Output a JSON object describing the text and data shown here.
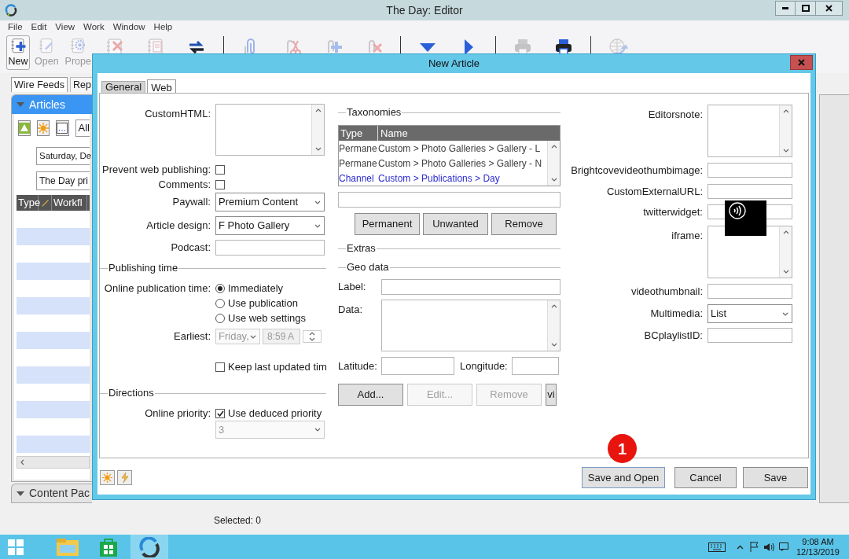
{
  "window": {
    "title": "The Day: Editor"
  },
  "menu": [
    "File",
    "Edit",
    "View",
    "Work",
    "Window",
    "Help"
  ],
  "toolbar": [
    {
      "kind": "new",
      "label": "New",
      "disabled": false,
      "highlighted": true
    },
    {
      "kind": "open",
      "label": "Open",
      "disabled": true,
      "highlighted": false
    },
    {
      "kind": "properties",
      "label": "Prope",
      "disabled": true,
      "highlighted": false
    },
    {
      "kind": "delete",
      "disabled": true,
      "highlighted": false
    },
    {
      "kind": "report",
      "disabled": true,
      "highlighted": false
    },
    {
      "kind": "sync",
      "disabled": false,
      "highlighted": false
    },
    {
      "kind": "separator"
    },
    {
      "kind": "attach",
      "disabled": true,
      "highlighted": false
    },
    {
      "kind": "detach",
      "disabled": true,
      "highlighted": false
    },
    {
      "kind": "attach-add",
      "disabled": true,
      "highlighted": false
    },
    {
      "kind": "attach-remove",
      "disabled": true,
      "highlighted": false
    },
    {
      "kind": "separator"
    },
    {
      "kind": "down",
      "disabled": false,
      "highlighted": false
    },
    {
      "kind": "play",
      "disabled": false,
      "highlighted": false
    },
    {
      "kind": "separator"
    },
    {
      "kind": "print",
      "disabled": true,
      "highlighted": false
    },
    {
      "kind": "print-dark",
      "disabled": false,
      "highlighted": false
    },
    {
      "kind": "separator"
    },
    {
      "kind": "web",
      "disabled": true,
      "highlighted": false
    }
  ],
  "left_panel": {
    "tabs": [
      {
        "label": "Wire Feeds",
        "selected": true
      },
      {
        "label": "Rep",
        "selected": false
      }
    ],
    "articles": {
      "title": "Articles",
      "filter": "All",
      "date": "Saturday, De",
      "edition": "The Day pri",
      "columns": [
        {
          "kind": "text",
          "label": "Type"
        },
        {
          "kind": "pencil"
        },
        {
          "kind": "text",
          "label": "Workfl"
        }
      ]
    },
    "content_panel": {
      "title": "Content Pac"
    }
  },
  "dialog": {
    "title": "New Article",
    "tabs": [
      {
        "label": "General",
        "selected": false
      },
      {
        "label": "Web",
        "selected": true
      }
    ],
    "left": {
      "fields": [
        {
          "kind": "textarea",
          "label": "CustomHTML:"
        },
        {
          "kind": "checkbox",
          "label": "Prevent web publishing:",
          "checked": false
        },
        {
          "kind": "checkbox",
          "label": "Comments:",
          "checked": false
        },
        {
          "kind": "select",
          "label": "Paywall:",
          "value": "Premium Content"
        },
        {
          "kind": "select",
          "label": "Article design:",
          "value": "F Photo Gallery"
        },
        {
          "kind": "input",
          "label": "Podcast:"
        }
      ],
      "publishing_time": {
        "title": "Publishing time",
        "label": "Online publication time:",
        "options": [
          {
            "label": "Immediately",
            "selected": true
          },
          {
            "label": "Use publication",
            "selected": false
          },
          {
            "label": "Use web settings",
            "selected": false
          }
        ],
        "earliest": {
          "label": "Earliest:",
          "day": "Friday,",
          "time": "8:59 A",
          "disabled": true
        },
        "keep_last_updated": {
          "label": "Keep last updated tim",
          "checked": false
        }
      },
      "directions": {
        "title": "Directions",
        "label": "Online priority:",
        "checkbox_label": "Use deduced priority",
        "checked": true,
        "priority": "3",
        "priority_disabled": true
      }
    },
    "middle": {
      "taxonomies": {
        "title": "Taxonomies",
        "columns": [
          "Type",
          "Name"
        ],
        "rows": [
          {
            "type": "Permane",
            "name": "Custom > Photo Galleries > Gallery - L",
            "color": "#404040"
          },
          {
            "type": "Permane",
            "name": "Custom > Photo Galleries > Gallery - N",
            "color": "#404040"
          },
          {
            "type": "Channel",
            "name": "Custom > Publications > Day",
            "color": "#2b2bd0"
          }
        ],
        "buttons": [
          "Permanent",
          "Unwanted",
          "Remove"
        ]
      },
      "extras": {
        "title": "Extras"
      },
      "geo_data": {
        "title": "Geo data",
        "label_label": "Label:",
        "data_label": "Data:",
        "latitude_label": "Latitude:",
        "longitude_label": "Longitude:",
        "buttons": [
          {
            "label": "Add...",
            "disabled": false
          },
          {
            "label": "Edit...",
            "disabled": true
          },
          {
            "label": "Remove",
            "disabled": true
          },
          {
            "label": "vi",
            "disabled": false
          }
        ]
      }
    },
    "right": {
      "fields": [
        {
          "kind": "textarea",
          "label": "Editorsnote:"
        },
        {
          "kind": "input",
          "label": "Brightcovevideothumbimage:"
        },
        {
          "kind": "input",
          "label": "CustomExternalURL:"
        },
        {
          "kind": "input",
          "label": "twitterwidget:"
        },
        {
          "kind": "textarea",
          "label": "iframe:"
        },
        {
          "kind": "input",
          "label": "videothumbnail:"
        },
        {
          "kind": "select",
          "label": "Multimedia:",
          "value": "List"
        },
        {
          "kind": "input",
          "label": "BCplaylistID:"
        }
      ]
    },
    "footer_buttons": [
      "Save and Open",
      "Cancel",
      "Save"
    ],
    "callout": "1"
  },
  "status_bar": {
    "text": "Selected: 0"
  },
  "taskbar": {
    "apps": [
      {
        "kind": "explorer",
        "selected": false
      },
      {
        "kind": "store",
        "selected": false
      },
      {
        "kind": "editor",
        "selected": true
      }
    ],
    "time": "9:08 AM",
    "date": "12/13/2019"
  }
}
